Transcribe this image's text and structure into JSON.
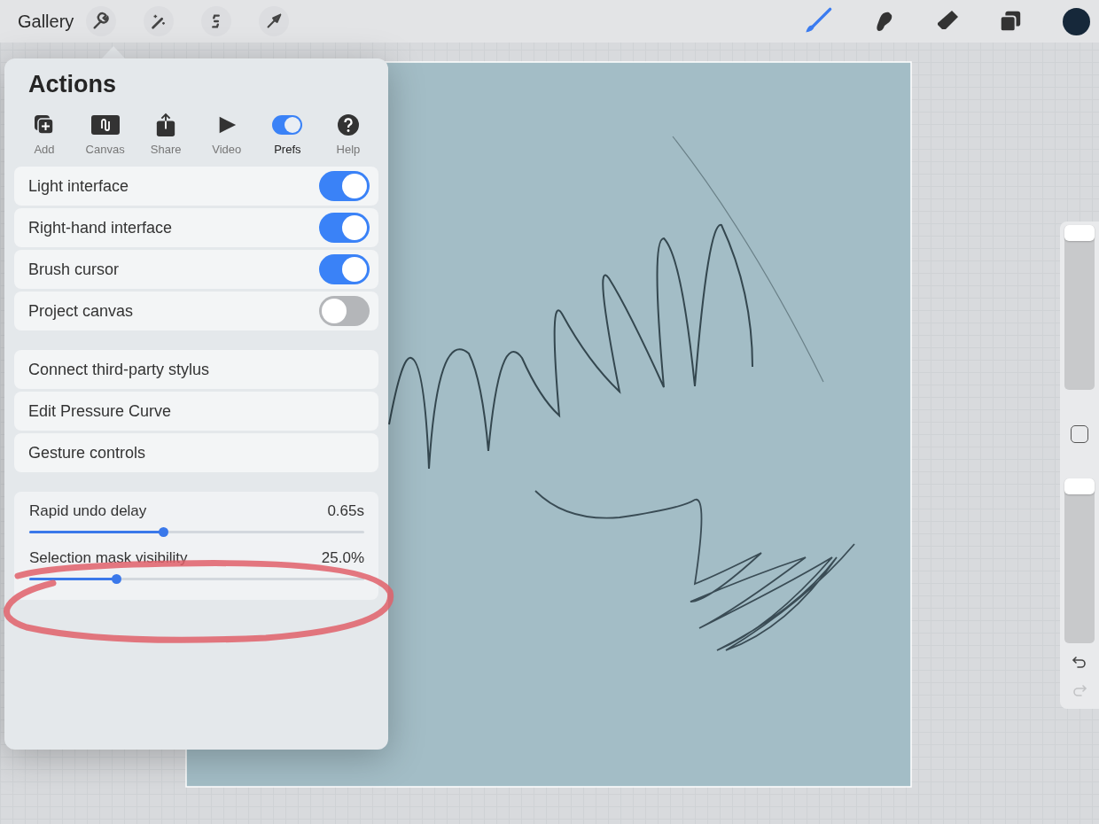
{
  "top_bar": {
    "gallery": "Gallery",
    "right_tools": [
      {
        "selected": true
      },
      {
        "selected": false
      },
      {
        "selected": false
      },
      {
        "selected": false
      }
    ],
    "color": "#16283a"
  },
  "actions_panel": {
    "title": "Actions",
    "tabs": [
      {
        "label": "Add",
        "selected": false
      },
      {
        "label": "Canvas",
        "selected": false
      },
      {
        "label": "Share",
        "selected": false
      },
      {
        "label": "Video",
        "selected": false
      },
      {
        "label": "Prefs",
        "selected": true
      },
      {
        "label": "Help",
        "selected": false
      }
    ],
    "toggles": [
      {
        "label": "Light interface",
        "on": true
      },
      {
        "label": "Right-hand interface",
        "on": true
      },
      {
        "label": "Brush cursor",
        "on": true
      },
      {
        "label": "Project canvas",
        "on": false
      }
    ],
    "links": [
      "Connect third-party stylus",
      "Edit Pressure Curve",
      "Gesture controls"
    ],
    "sliders": [
      {
        "label": "Rapid undo delay",
        "reading": "0.65s",
        "level": 0.4
      },
      {
        "label": "Selection mask visibility",
        "reading": "25.0%",
        "level": 0.26
      }
    ]
  },
  "side_bar": {
    "sliders": [
      {
        "level": 1
      },
      {
        "level": 1
      }
    ],
    "undo": {
      "disabled": false
    },
    "redo": {
      "disabled": true
    }
  }
}
